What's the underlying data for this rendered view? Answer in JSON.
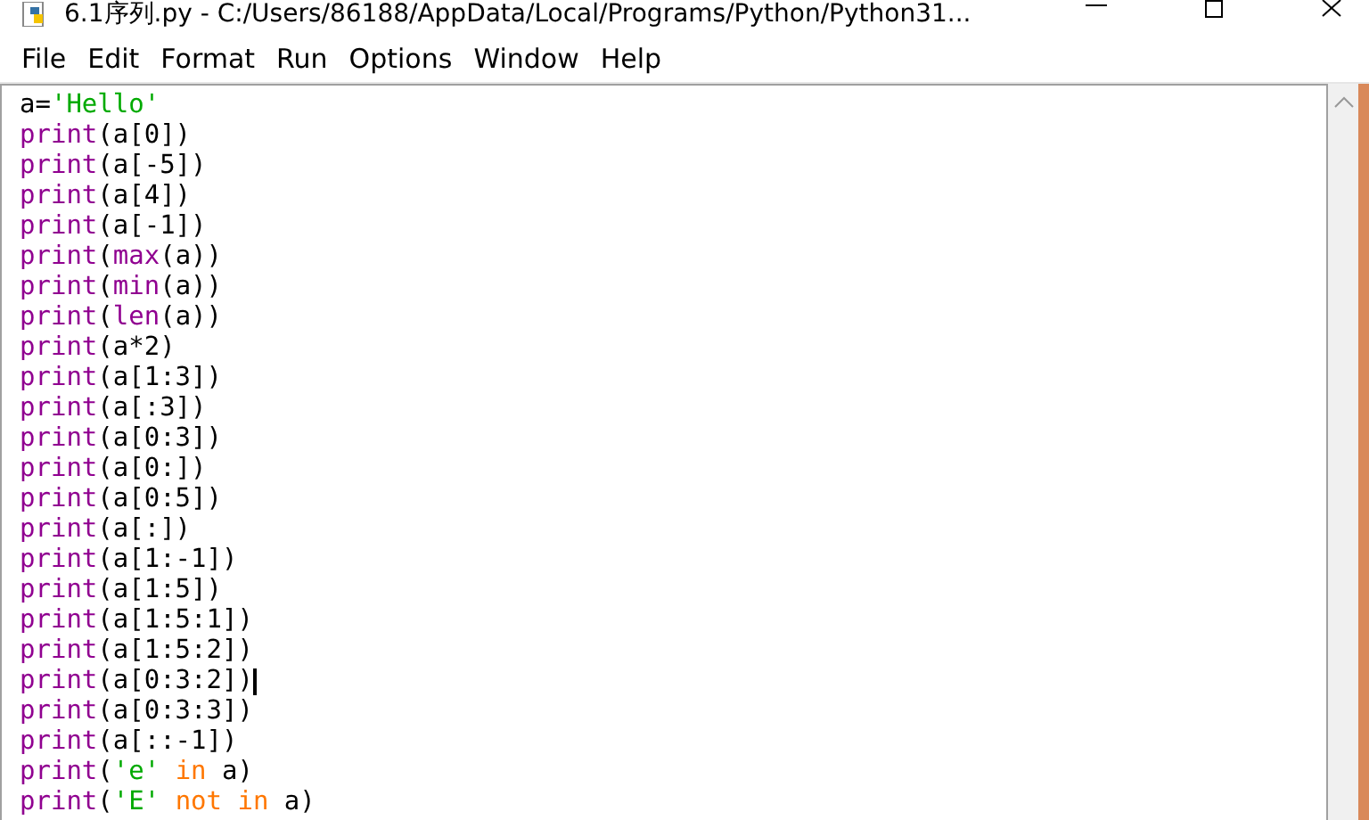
{
  "window": {
    "title": "6.1序列.py - C:/Users/86188/AppData/Local/Programs/Python/Python31..."
  },
  "menu": [
    "File",
    "Edit",
    "Format",
    "Run",
    "Options",
    "Window",
    "Help"
  ],
  "lines": [
    {
      "has_cursor": false,
      "tokens": [
        {
          "kind": "plain",
          "text": "a="
        },
        {
          "kind": "string",
          "text": "'Hello'"
        }
      ]
    },
    {
      "has_cursor": false,
      "tokens": [
        {
          "kind": "builtin",
          "text": "print"
        },
        {
          "kind": "plain",
          "text": "(a[0])"
        }
      ]
    },
    {
      "has_cursor": false,
      "tokens": [
        {
          "kind": "builtin",
          "text": "print"
        },
        {
          "kind": "plain",
          "text": "(a[-5])"
        }
      ]
    },
    {
      "has_cursor": false,
      "tokens": [
        {
          "kind": "builtin",
          "text": "print"
        },
        {
          "kind": "plain",
          "text": "(a[4])"
        }
      ]
    },
    {
      "has_cursor": false,
      "tokens": [
        {
          "kind": "builtin",
          "text": "print"
        },
        {
          "kind": "plain",
          "text": "(a[-1])"
        }
      ]
    },
    {
      "has_cursor": false,
      "tokens": [
        {
          "kind": "builtin",
          "text": "print"
        },
        {
          "kind": "plain",
          "text": "("
        },
        {
          "kind": "builtin",
          "text": "max"
        },
        {
          "kind": "plain",
          "text": "(a))"
        }
      ]
    },
    {
      "has_cursor": false,
      "tokens": [
        {
          "kind": "builtin",
          "text": "print"
        },
        {
          "kind": "plain",
          "text": "("
        },
        {
          "kind": "builtin",
          "text": "min"
        },
        {
          "kind": "plain",
          "text": "(a))"
        }
      ]
    },
    {
      "has_cursor": false,
      "tokens": [
        {
          "kind": "builtin",
          "text": "print"
        },
        {
          "kind": "plain",
          "text": "("
        },
        {
          "kind": "builtin",
          "text": "len"
        },
        {
          "kind": "plain",
          "text": "(a))"
        }
      ]
    },
    {
      "has_cursor": false,
      "tokens": [
        {
          "kind": "builtin",
          "text": "print"
        },
        {
          "kind": "plain",
          "text": "(a*2)"
        }
      ]
    },
    {
      "has_cursor": false,
      "tokens": [
        {
          "kind": "builtin",
          "text": "print"
        },
        {
          "kind": "plain",
          "text": "(a[1:3])"
        }
      ]
    },
    {
      "has_cursor": false,
      "tokens": [
        {
          "kind": "builtin",
          "text": "print"
        },
        {
          "kind": "plain",
          "text": "(a[:3])"
        }
      ]
    },
    {
      "has_cursor": false,
      "tokens": [
        {
          "kind": "builtin",
          "text": "print"
        },
        {
          "kind": "plain",
          "text": "(a[0:3])"
        }
      ]
    },
    {
      "has_cursor": false,
      "tokens": [
        {
          "kind": "builtin",
          "text": "print"
        },
        {
          "kind": "plain",
          "text": "(a[0:])"
        }
      ]
    },
    {
      "has_cursor": false,
      "tokens": [
        {
          "kind": "builtin",
          "text": "print"
        },
        {
          "kind": "plain",
          "text": "(a[0:5])"
        }
      ]
    },
    {
      "has_cursor": false,
      "tokens": [
        {
          "kind": "builtin",
          "text": "print"
        },
        {
          "kind": "plain",
          "text": "(a[:])"
        }
      ]
    },
    {
      "has_cursor": false,
      "tokens": [
        {
          "kind": "builtin",
          "text": "print"
        },
        {
          "kind": "plain",
          "text": "(a[1:-1])"
        }
      ]
    },
    {
      "has_cursor": false,
      "tokens": [
        {
          "kind": "builtin",
          "text": "print"
        },
        {
          "kind": "plain",
          "text": "(a[1:5])"
        }
      ]
    },
    {
      "has_cursor": false,
      "tokens": [
        {
          "kind": "builtin",
          "text": "print"
        },
        {
          "kind": "plain",
          "text": "(a[1:5:1])"
        }
      ]
    },
    {
      "has_cursor": false,
      "tokens": [
        {
          "kind": "builtin",
          "text": "print"
        },
        {
          "kind": "plain",
          "text": "(a[1:5:2])"
        }
      ]
    },
    {
      "has_cursor": true,
      "tokens": [
        {
          "kind": "builtin",
          "text": "print"
        },
        {
          "kind": "plain",
          "text": "(a[0:3:2])"
        }
      ]
    },
    {
      "has_cursor": false,
      "tokens": [
        {
          "kind": "builtin",
          "text": "print"
        },
        {
          "kind": "plain",
          "text": "(a[0:3:3])"
        }
      ]
    },
    {
      "has_cursor": false,
      "tokens": [
        {
          "kind": "builtin",
          "text": "print"
        },
        {
          "kind": "plain",
          "text": "(a[::-1])"
        }
      ]
    },
    {
      "has_cursor": false,
      "tokens": [
        {
          "kind": "builtin",
          "text": "print"
        },
        {
          "kind": "plain",
          "text": "("
        },
        {
          "kind": "string",
          "text": "'e'"
        },
        {
          "kind": "keyword",
          "text": " in"
        },
        {
          "kind": "plain",
          "text": " a)"
        }
      ]
    },
    {
      "has_cursor": false,
      "tokens": [
        {
          "kind": "builtin",
          "text": "print"
        },
        {
          "kind": "plain",
          "text": "("
        },
        {
          "kind": "string",
          "text": "'E'"
        },
        {
          "kind": "keyword",
          "text": " not in"
        },
        {
          "kind": "plain",
          "text": " a)"
        }
      ]
    }
  ]
}
